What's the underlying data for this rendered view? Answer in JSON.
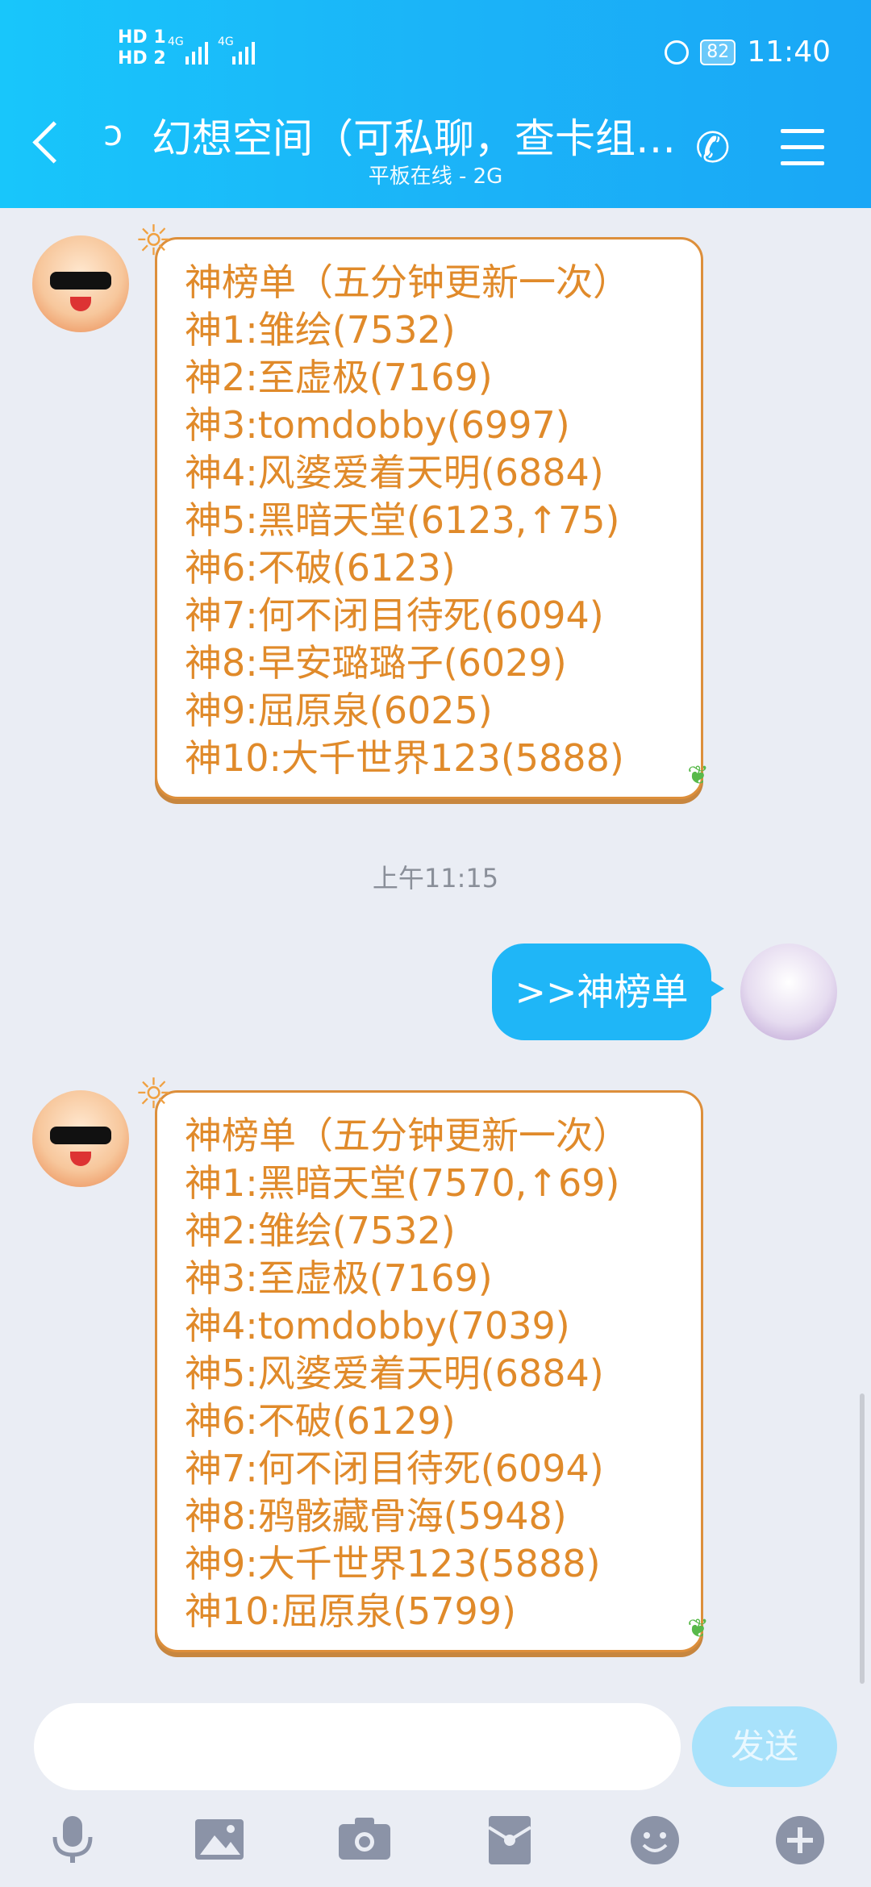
{
  "status_bar": {
    "hd1": "HD 1",
    "hd2": "HD 2",
    "net1": "4G",
    "net2": "4G",
    "battery": "82",
    "time": "11:40"
  },
  "header": {
    "title": "幻想空间（可私聊，查卡组…",
    "subtitle": "平板在线 - 2G"
  },
  "messages": {
    "first": {
      "lines": [
        "神榜单（五分钟更新一次）",
        "神1:雏绘(7532)",
        "神2:至虚极(7169)",
        "神3:tomdobby(6997)",
        "神4:风婆爱着天明(6884)",
        "神5:黑暗天堂(6123,↑75)",
        "神6:不破(6123)",
        "神7:何不闭目待死(6094)",
        "神8:早安璐璐子(6029)",
        "神9:屈原泉(6025)",
        "神10:大千世界123(5888)"
      ]
    },
    "timestamp": "上午11:15",
    "sent": ">>神榜单",
    "second": {
      "lines": [
        "神榜单（五分钟更新一次）",
        "神1:黑暗天堂(7570,↑69)",
        "神2:雏绘(7532)",
        "神3:至虚极(7169)",
        "神4:tomdobby(7039)",
        "神5:风婆爱着天明(6884)",
        "神6:不破(6129)",
        "神7:何不闭目待死(6094)",
        "神8:鸦骸藏骨海(5948)",
        "神9:大千世界123(5888)",
        "神10:屈原泉(5799)"
      ]
    }
  },
  "input": {
    "placeholder": "",
    "send_label": "发送"
  },
  "toolbar": {
    "icons": [
      "microphone-icon",
      "image-icon",
      "camera-icon",
      "red-packet-icon",
      "emoji-icon",
      "plus-icon"
    ]
  },
  "colors": {
    "header": "#1bb4f8",
    "bubble_text": "#e08a2a",
    "bubble_border": "#dd8f3b",
    "my_bubble": "#1fb6f7"
  }
}
